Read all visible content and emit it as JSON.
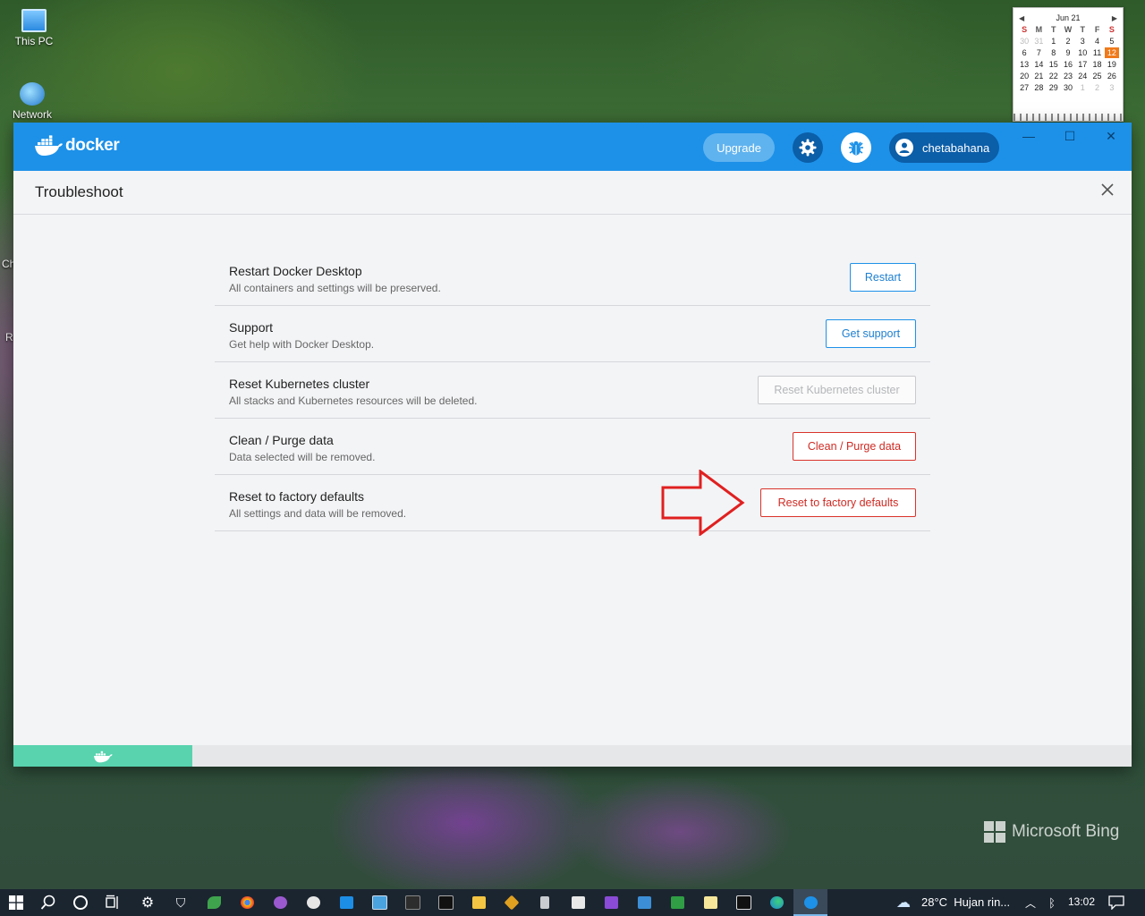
{
  "desktop": {
    "icons": [
      {
        "label": "This PC"
      },
      {
        "label": "Network"
      }
    ],
    "side_labels": [
      "Ch",
      "R"
    ],
    "calendar": {
      "month_label": "Jun 21",
      "weekdays": [
        "S",
        "M",
        "T",
        "W",
        "T",
        "F",
        "S"
      ],
      "weeks": [
        [
          "30",
          "31",
          "1",
          "2",
          "3",
          "4",
          "5"
        ],
        [
          "6",
          "7",
          "8",
          "9",
          "10",
          "11",
          "12"
        ],
        [
          "13",
          "14",
          "15",
          "16",
          "17",
          "18",
          "19"
        ],
        [
          "20",
          "21",
          "22",
          "23",
          "24",
          "25",
          "26"
        ],
        [
          "27",
          "28",
          "29",
          "30",
          "1",
          "2",
          "3"
        ]
      ],
      "today": "12"
    },
    "watermark": "Microsoft Bing"
  },
  "docker": {
    "logo_text": "docker",
    "upgrade_label": "Upgrade",
    "username": "chetabahana",
    "window_controls": {
      "minimize": "—",
      "maximize": "☐",
      "close": "✕"
    },
    "page_title": "Troubleshoot",
    "rows": [
      {
        "title": "Restart Docker Desktop",
        "subtitle": "All containers and settings will be preserved.",
        "button": "Restart"
      },
      {
        "title": "Support",
        "subtitle": "Get help with Docker Desktop.",
        "button": "Get support"
      },
      {
        "title": "Reset Kubernetes cluster",
        "subtitle": "All stacks and Kubernetes resources will be deleted.",
        "button": "Reset Kubernetes cluster"
      },
      {
        "title": "Clean / Purge data",
        "subtitle": "Data selected will be removed.",
        "button": "Clean / Purge data"
      },
      {
        "title": "Reset to factory defaults",
        "subtitle": "All settings and data will be removed.",
        "button": "Reset to factory defaults"
      }
    ],
    "colors": {
      "brand": "#1d91e8",
      "danger": "#d9332b",
      "status": "#58d3ae",
      "annotation_arrow": "#e02020"
    }
  },
  "taskbar": {
    "weather": "28°C  Hujan rin...",
    "time": "13:02"
  }
}
